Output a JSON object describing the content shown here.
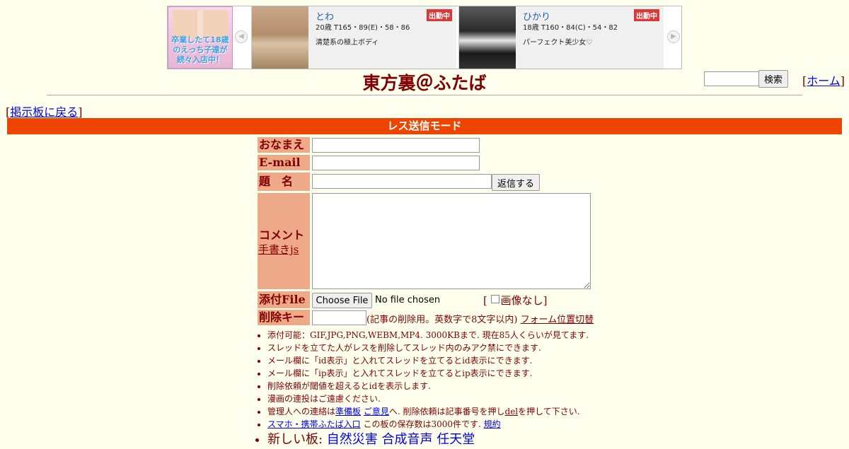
{
  "ad": {
    "side_promo": "卒業したて18歳のえっち子達が続々入店中！",
    "cards": [
      {
        "name": "とわ",
        "specs": "20歳 T165・89(E)・58・86",
        "desc": "清楚系の極上ボディ",
        "badge": "出勤中"
      },
      {
        "name": "ひかり",
        "specs": "18歳 T160・84(C)・54・82",
        "desc": "パーフェクト美少女♡",
        "badge": "出勤中"
      }
    ],
    "left_arrow": "◀",
    "right_arrow": "▶"
  },
  "header": {
    "title": "東方裏＠ふたば",
    "search_button": "検索",
    "home_prefix": "[",
    "home_link": "ホーム",
    "home_suffix": "]"
  },
  "nav": {
    "back_prefix": "[",
    "back_link": "掲示板に戻る",
    "back_suffix": "]"
  },
  "mode_bar": "レス送信モード",
  "form": {
    "name_label": "おなまえ",
    "email_label": "E-mail",
    "subject_label": "題　名",
    "reply_button": "返信する",
    "comment_label": "コメント",
    "tegaki_link": "手書きjs",
    "file_label": "添付File",
    "file_button": "Choose File",
    "file_status": "No file chosen",
    "noimage_prefix": "[",
    "noimage_label": "画像なし",
    "noimage_suffix": "]",
    "delkey_label": "削除キー",
    "delkey_note": "(記事の削除用。英数字で8文字以内)",
    "form_switch": "フォーム位置切替"
  },
  "rules": [
    "添付可能：GIF,JPG,PNG,WEBM,MP4. 3000KBまで. 現在85人くらいが見てます.",
    "スレッドを立てた人がレスを削除してスレッド内のみアク禁にできます.",
    "メール欄に「id表示」と入れてスレッドを立てるとid表示にできます.",
    "メール欄に「ip表示」と入れてスレッドを立てるとip表示にできます.",
    "削除依頼が閾値を超えるとidを表示します.",
    "漫画の連投はご遠慮ください."
  ],
  "contact": {
    "prefix": "管理人への連絡は",
    "link1": "準備板",
    "link2": "ご意見",
    "middle": "へ. 削除依頼は記事番号を押し",
    "del": "del",
    "suffix": "を押して下さい."
  },
  "mobile": {
    "link": "スマホ・携帯ふたば入口",
    "text": " この板の保存数は3000件です. ",
    "rules_link": "規約"
  },
  "new_boards": {
    "label": "新しい板: ",
    "boards": [
      "自然災害",
      "合成音声",
      "任天堂"
    ]
  }
}
